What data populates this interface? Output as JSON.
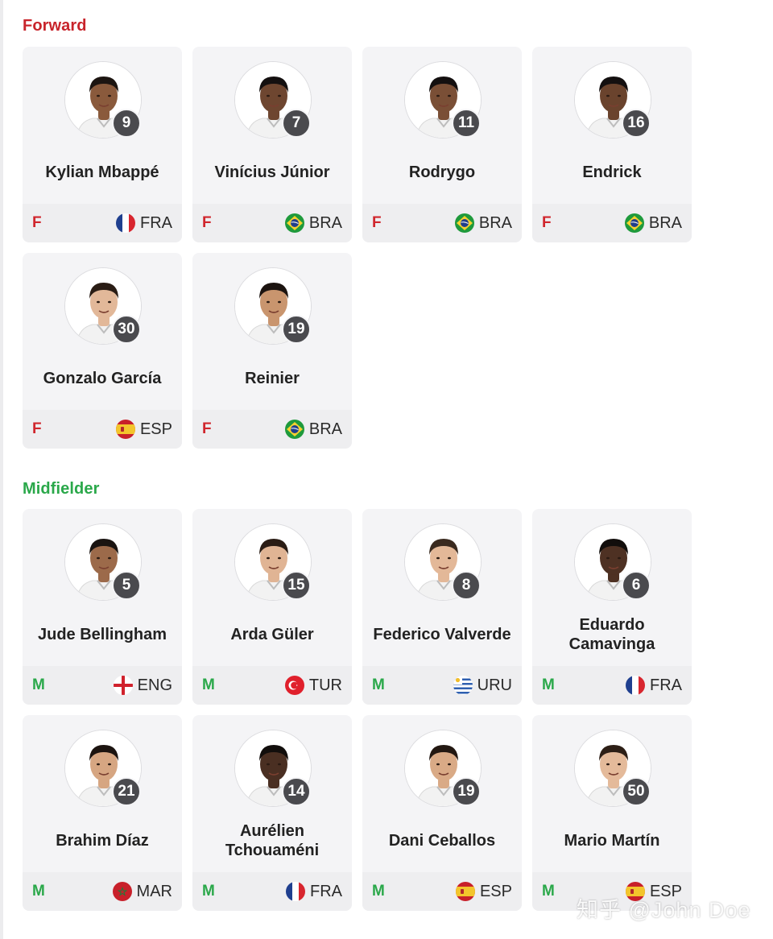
{
  "sections": [
    {
      "title": "Forward",
      "players": [
        {
          "name": "Kylian Mbappé",
          "number": "9",
          "position": "F",
          "nation": "FRA",
          "flag": "fr-flag-icon",
          "skin": "#8a5a3c",
          "hair": "#1d1511"
        },
        {
          "name": "Vinícius Júnior",
          "number": "7",
          "position": "F",
          "nation": "BRA",
          "flag": "br-flag-icon",
          "skin": "#6e4630",
          "hair": "#141010"
        },
        {
          "name": "Rodrygo",
          "number": "11",
          "position": "F",
          "nation": "BRA",
          "flag": "br-flag-icon",
          "skin": "#7a4f36",
          "hair": "#141010"
        },
        {
          "name": "Endrick",
          "number": "16",
          "position": "F",
          "nation": "BRA",
          "flag": "br-flag-icon",
          "skin": "#6a432d",
          "hair": "#141010"
        },
        {
          "name": "Gonzalo García",
          "number": "30",
          "position": "F",
          "nation": "ESP",
          "flag": "es-flag-icon",
          "skin": "#e2b899",
          "hair": "#2a1d15"
        },
        {
          "name": "Reinier",
          "number": "19",
          "position": "F",
          "nation": "BRA",
          "flag": "br-flag-icon",
          "skin": "#c9956e",
          "hair": "#1c1410"
        }
      ]
    },
    {
      "title": "Midfielder",
      "players": [
        {
          "name": "Jude Bellingham",
          "number": "5",
          "position": "M",
          "nation": "ENG",
          "flag": "en-flag-icon",
          "skin": "#9c6a4a",
          "hair": "#1a1411"
        },
        {
          "name": "Arda Güler",
          "number": "15",
          "position": "M",
          "nation": "TUR",
          "flag": "tr-flag-icon",
          "skin": "#e0b494",
          "hair": "#2a1c14"
        },
        {
          "name": "Federico Valverde",
          "number": "8",
          "position": "M",
          "nation": "URU",
          "flag": "uy-flag-icon",
          "skin": "#e3b898",
          "hair": "#3a2a1f"
        },
        {
          "name": "Eduardo Camavinga",
          "number": "6",
          "position": "M",
          "nation": "FRA",
          "flag": "fr-flag-icon",
          "skin": "#4e3123",
          "hair": "#120e0c"
        },
        {
          "name": "Brahim Díaz",
          "number": "21",
          "position": "M",
          "nation": "MAR",
          "flag": "ma-flag-icon",
          "skin": "#d6a682",
          "hair": "#1c1410"
        },
        {
          "name": "Aurélien Tchouaméni",
          "number": "14",
          "position": "M",
          "nation": "FRA",
          "flag": "fr-flag-icon",
          "skin": "#4a2f22",
          "hair": "#120e0c"
        },
        {
          "name": "Dani Ceballos",
          "number": "19",
          "position": "M",
          "nation": "ESP",
          "flag": "es-flag-icon",
          "skin": "#d9aa86",
          "hair": "#231812"
        },
        {
          "name": "Mario Martín",
          "number": "50",
          "position": "M",
          "nation": "ESP",
          "flag": "es-flag-icon",
          "skin": "#e4ba9a",
          "hair": "#2d1f16"
        }
      ]
    }
  ],
  "watermark": "知乎 @John Doe",
  "colors": {
    "forward": "#c8242b",
    "midfielder": "#2aa84a",
    "number_badge": "#4a4a4e",
    "card": "#f4f4f6"
  }
}
